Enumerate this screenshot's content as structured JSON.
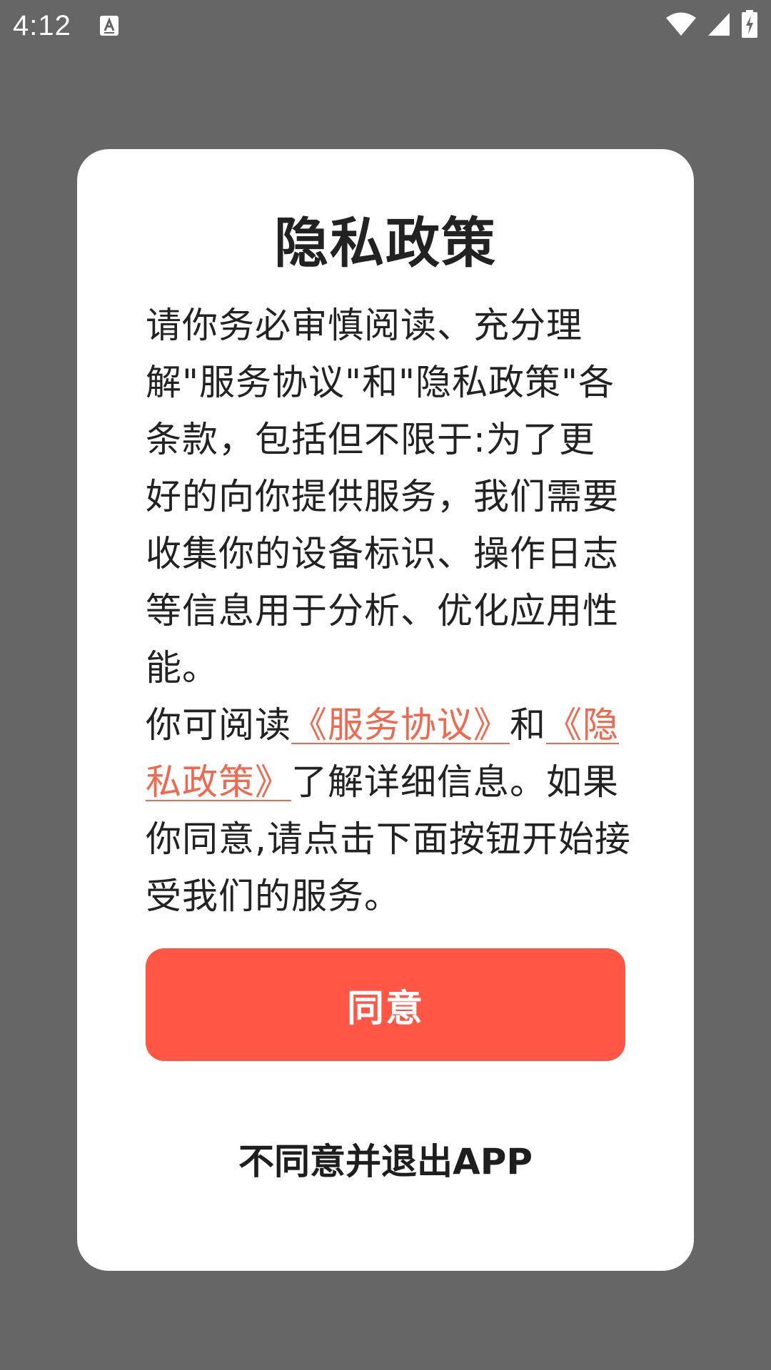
{
  "status_bar": {
    "time": "4:12"
  },
  "dialog": {
    "title": "隐私政策",
    "body_text": "请你务必审慎阅读、充分理解\"服务协议\"和\"隐私政策\"各条款，包括但不限于:为了更好的向你提供服务，我们需要收集你的设备标识、操作日志等信息用于分析、优化应用性能。",
    "read_prefix": "你可阅读",
    "service_link": "《服务协议》",
    "and_text": "和",
    "privacy_link": "《隐私政策》",
    "read_suffix": "了解详细信息。如果你同意,请点击下面按钮开始接受我们的服务。",
    "agree_label": "同意",
    "disagree_label": "不同意并退出APP"
  },
  "colors": {
    "accent": "#ff5645",
    "link": "#f2684f",
    "overlay": "#666666"
  },
  "icons": {
    "status_left": "text-format-icon",
    "status_right": [
      "wifi-icon",
      "cellular-signal-icon",
      "battery-charging-icon"
    ]
  }
}
